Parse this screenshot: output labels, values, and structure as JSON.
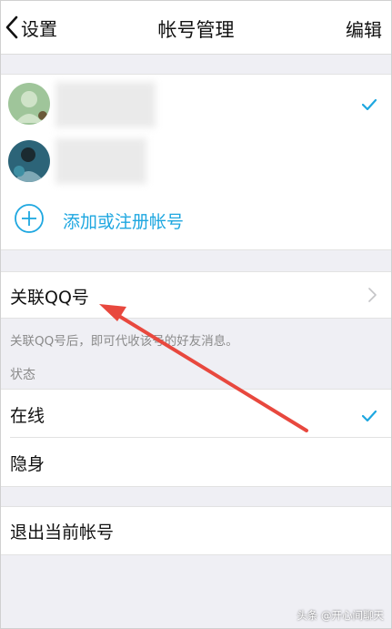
{
  "nav": {
    "back_label": "设置",
    "title": "帐号管理",
    "edit_label": "编辑"
  },
  "accounts": {
    "add_label": "添加或注册帐号"
  },
  "link_qq": {
    "label": "关联QQ号",
    "hint": "关联QQ号后，即可代收该号的好友消息。"
  },
  "status": {
    "section_label": "状态",
    "options": [
      {
        "label": "在线",
        "selected": true
      },
      {
        "label": "隐身",
        "selected": false
      }
    ]
  },
  "logout_label": "退出当前帐号",
  "watermark": "头条 @开心间聊天",
  "colors": {
    "accent": "#1ea7e0",
    "annotation_arrow": "#e8483e",
    "background": "#efeff4"
  }
}
